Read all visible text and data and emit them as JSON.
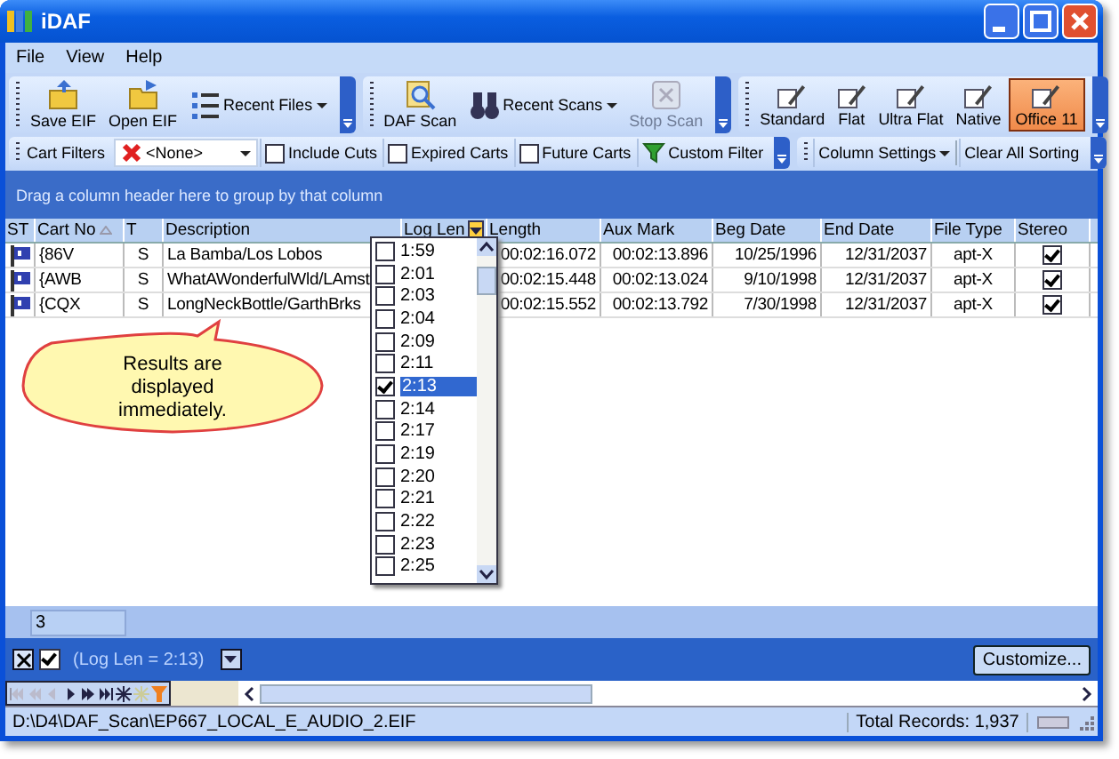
{
  "window": {
    "title": "iDAF"
  },
  "menu": [
    "File",
    "View",
    "Help"
  ],
  "toolbar_file": [
    {
      "label": "Save EIF",
      "kind": "large",
      "disabled": false
    },
    {
      "label": "Open EIF",
      "kind": "large",
      "disabled": false
    },
    {
      "label": "Recent Files",
      "kind": "dropdown",
      "disabled": false
    }
  ],
  "toolbar_scan": [
    {
      "label": "DAF Scan",
      "kind": "large",
      "disabled": false
    },
    {
      "label": "Recent Scans",
      "kind": "dropdown",
      "disabled": false
    },
    {
      "label": "Stop Scan",
      "kind": "large",
      "disabled": true
    }
  ],
  "toolbar_style": [
    {
      "label": "Standard",
      "selected": false
    },
    {
      "label": "Flat",
      "selected": false
    },
    {
      "label": "Ultra Flat",
      "selected": false
    },
    {
      "label": "Native",
      "selected": false
    },
    {
      "label": "Office 11",
      "selected": true
    }
  ],
  "filter_toolbar": {
    "label": "Cart Filters",
    "combo_value": "<None>",
    "checkboxes": [
      {
        "label": "Include Cuts",
        "checked": false
      },
      {
        "label": "Expired Carts",
        "checked": false
      },
      {
        "label": "Future Carts",
        "checked": false
      }
    ],
    "custom_filter": "Custom Filter",
    "column_settings": "Column Settings",
    "clear_sorting": "Clear All Sorting"
  },
  "group_panel": "Drag a column header here to group by that column",
  "grid": {
    "columns": [
      {
        "label": "ST",
        "sorted": false,
        "filtered": false
      },
      {
        "label": "Cart No",
        "sorted": true,
        "filtered": false
      },
      {
        "label": "T",
        "sorted": false,
        "filtered": false
      },
      {
        "label": "Description",
        "sorted": false,
        "filtered": false
      },
      {
        "label": "Log Len",
        "sorted": false,
        "filtered": true
      },
      {
        "label": "Length",
        "sorted": false,
        "filtered": false
      },
      {
        "label": "Aux Mark",
        "sorted": false,
        "filtered": false
      },
      {
        "label": "Beg Date",
        "sorted": false,
        "filtered": false
      },
      {
        "label": "End Date",
        "sorted": false,
        "filtered": false
      },
      {
        "label": "File Type",
        "sorted": false,
        "filtered": false
      },
      {
        "label": "Stereo",
        "sorted": false,
        "filtered": false
      }
    ],
    "rows": [
      {
        "cart_no": "{86V",
        "t": "S",
        "description": "La Bamba/Los Lobos",
        "length": "00:02:16.072",
        "aux_mark": "00:02:13.896",
        "beg_date": "10/25/1996",
        "end_date": "12/31/2037",
        "file_type": "apt-X",
        "stereo": true
      },
      {
        "cart_no": "{AWB",
        "t": "S",
        "description": "WhatAWonderfulWld/LAmst",
        "length": "00:02:15.448",
        "aux_mark": "00:02:13.024",
        "beg_date": "9/10/1998",
        "end_date": "12/31/2037",
        "file_type": "apt-X",
        "stereo": true
      },
      {
        "cart_no": "{CQX",
        "t": "S",
        "description": "LongNeckBottle/GarthBrks",
        "length": "00:02:15.552",
        "aux_mark": "00:02:13.792",
        "beg_date": "7/30/1998",
        "end_date": "12/31/2037",
        "file_type": "apt-X",
        "stereo": true
      }
    ],
    "footer_count": "3"
  },
  "filter_dropdown": [
    {
      "label": "1:59",
      "checked": false,
      "selected": false
    },
    {
      "label": "2:01",
      "checked": false,
      "selected": false
    },
    {
      "label": "2:03",
      "checked": false,
      "selected": false
    },
    {
      "label": "2:04",
      "checked": false,
      "selected": false
    },
    {
      "label": "2:09",
      "checked": false,
      "selected": false
    },
    {
      "label": "2:11",
      "checked": false,
      "selected": false
    },
    {
      "label": "2:13",
      "checked": true,
      "selected": true
    },
    {
      "label": "2:14",
      "checked": false,
      "selected": false
    },
    {
      "label": "2:17",
      "checked": false,
      "selected": false
    },
    {
      "label": "2:19",
      "checked": false,
      "selected": false
    },
    {
      "label": "2:20",
      "checked": false,
      "selected": false
    },
    {
      "label": "2:21",
      "checked": false,
      "selected": false
    },
    {
      "label": "2:22",
      "checked": false,
      "selected": false
    },
    {
      "label": "2:23",
      "checked": false,
      "selected": false
    },
    {
      "label": "2:25",
      "checked": false,
      "selected": false
    }
  ],
  "callout": "Results are displayed immediately.",
  "filter_bar": {
    "enabled": true,
    "expression": "(Log Len = 2:13)",
    "customize": "Customize..."
  },
  "status_bar": {
    "path": "D:\\D4\\DAF_Scan\\EP667_LOCAL_E_AUDIO_2.EIF",
    "total": "Total Records: 1,937"
  }
}
